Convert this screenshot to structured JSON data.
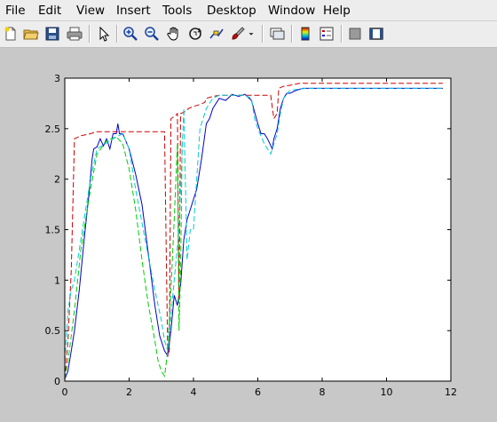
{
  "menu": {
    "items": [
      {
        "label": "File"
      },
      {
        "label": "Edit"
      },
      {
        "label": "View"
      },
      {
        "label": "Insert"
      },
      {
        "label": "Tools"
      },
      {
        "label": "Desktop"
      },
      {
        "label": "Window"
      },
      {
        "label": "Help"
      }
    ]
  },
  "toolbar": {
    "buttons": [
      {
        "icon": "new-file-icon"
      },
      {
        "icon": "open-folder-icon"
      },
      {
        "icon": "save-icon"
      },
      {
        "icon": "print-icon"
      },
      {
        "icon": "pointer-arrow-icon"
      },
      {
        "icon": "zoom-in-icon"
      },
      {
        "icon": "zoom-out-icon"
      },
      {
        "icon": "pan-hand-icon"
      },
      {
        "icon": "rotate-3d-icon"
      },
      {
        "icon": "data-cursor-icon"
      },
      {
        "icon": "brush-icon"
      },
      {
        "icon": "dropdown-arrow-icon"
      },
      {
        "icon": "link-plot-icon"
      },
      {
        "icon": "colorbar-icon"
      },
      {
        "icon": "legend-icon"
      },
      {
        "icon": "hide-plot-tools-icon"
      },
      {
        "icon": "show-plot-tools-icon"
      }
    ]
  },
  "chart_data": {
    "type": "line",
    "title": "",
    "xlabel": "",
    "ylabel": "",
    "xlim": [
      0,
      12
    ],
    "ylim": [
      0,
      3
    ],
    "xticks": [
      "0",
      "2",
      "4",
      "6",
      "8",
      "10",
      "12"
    ],
    "yticks": [
      "0",
      "0.5",
      "1",
      "1.5",
      "2",
      "2.5",
      "3"
    ],
    "grid": false,
    "series": [
      {
        "color": "#0000cc",
        "style": "solid",
        "x": [
          0,
          0.1,
          0.2,
          0.3,
          0.45,
          0.6,
          0.75,
          0.85,
          0.9,
          1.0,
          1.1,
          1.2,
          1.3,
          1.4,
          1.5,
          1.6,
          1.65,
          1.7,
          1.8,
          2.0,
          2.2,
          2.4,
          2.6,
          2.8,
          2.95,
          3.1,
          3.2,
          3.3,
          3.4,
          3.5,
          3.6,
          3.7,
          3.8,
          3.95,
          4.1,
          4.25,
          4.4,
          4.5,
          4.6,
          4.8,
          5.0,
          5.2,
          5.4,
          5.6,
          5.8,
          6.0,
          6.1,
          6.2,
          6.3,
          6.45,
          6.5,
          6.6,
          6.7,
          6.8,
          6.9,
          7.0,
          7.2,
          7.4,
          7.8,
          8.2,
          8.6,
          9.0,
          9.5,
          10.0,
          10.5,
          11.0,
          11.5,
          11.75
        ],
        "y": [
          0.02,
          0.1,
          0.3,
          0.5,
          0.9,
          1.4,
          1.85,
          2.2,
          2.3,
          2.32,
          2.4,
          2.33,
          2.4,
          2.3,
          2.45,
          2.45,
          2.55,
          2.45,
          2.45,
          2.3,
          2.05,
          1.75,
          1.25,
          0.75,
          0.45,
          0.3,
          0.25,
          0.5,
          0.85,
          0.75,
          0.95,
          1.4,
          1.6,
          1.75,
          1.9,
          2.2,
          2.55,
          2.6,
          2.7,
          2.8,
          2.78,
          2.84,
          2.82,
          2.84,
          2.78,
          2.55,
          2.45,
          2.45,
          2.4,
          2.3,
          2.4,
          2.5,
          2.7,
          2.8,
          2.85,
          2.85,
          2.88,
          2.9,
          2.9,
          2.9,
          2.9,
          2.9,
          2.9,
          2.9,
          2.9,
          2.9,
          2.9,
          2.9
        ]
      },
      {
        "color": "#cc0000",
        "style": "dashed",
        "x": [
          0,
          0.1,
          0.2,
          0.3,
          0.5,
          0.8,
          1.0,
          1.5,
          1.8,
          1.9,
          2.1,
          2.5,
          2.9,
          3.1,
          3.2,
          3.25,
          3.3,
          3.4,
          3.5,
          3.55,
          3.6,
          3.75,
          3.85,
          4.0,
          4.2,
          4.35,
          4.4,
          4.6,
          4.8,
          5.0,
          5.5,
          5.8,
          6.0,
          6.2,
          6.4,
          6.5,
          6.6,
          6.65,
          6.8,
          7.0,
          7.3,
          7.4,
          8.0,
          9.0,
          10.0,
          11.0,
          11.75
        ],
        "y": [
          0.02,
          0.4,
          1.1,
          2.4,
          2.43,
          2.45,
          2.47,
          2.47,
          2.47,
          2.47,
          2.47,
          2.47,
          2.47,
          2.47,
          0.25,
          0.3,
          2.6,
          2.62,
          2.65,
          0.8,
          2.65,
          2.67,
          2.7,
          2.72,
          2.74,
          2.76,
          2.8,
          2.82,
          2.83,
          2.83,
          2.83,
          2.83,
          2.83,
          2.83,
          2.83,
          2.6,
          2.65,
          2.9,
          2.92,
          2.93,
          2.95,
          2.95,
          2.95,
          2.95,
          2.95,
          2.95,
          2.95
        ]
      },
      {
        "color": "#00cc00",
        "style": "dashed",
        "x": [
          0,
          0.1,
          0.2,
          0.3,
          0.5,
          0.8,
          1.0,
          1.3,
          1.6,
          1.8,
          2.0,
          2.2,
          2.4,
          2.6,
          2.8,
          2.9,
          3.0,
          3.1,
          3.2,
          3.3,
          3.4,
          3.5,
          3.55,
          3.6,
          3.65
        ],
        "y": [
          0.02,
          0.2,
          0.45,
          0.7,
          1.3,
          1.9,
          2.25,
          2.38,
          2.42,
          2.35,
          2.1,
          1.7,
          1.2,
          0.75,
          0.4,
          0.2,
          0.1,
          0.05,
          0.3,
          0.9,
          1.6,
          2.35,
          0.5,
          1.1,
          2.4
        ]
      },
      {
        "color": "#00cccc",
        "style": "dashed",
        "x": [
          0,
          0.1,
          0.2,
          0.3,
          0.5,
          0.8,
          1.0,
          1.5,
          1.8,
          2.0,
          2.2,
          2.5,
          2.8,
          3.0,
          3.1,
          3.2,
          3.4,
          3.55,
          3.7,
          3.8,
          3.9,
          4.0,
          4.2,
          4.4,
          4.6,
          4.8,
          5.0,
          5.3,
          5.6,
          5.8,
          5.9,
          6.0,
          6.2,
          6.4,
          6.5,
          6.6,
          6.7,
          6.8,
          7.0,
          7.5,
          8.0,
          9.0,
          10.0,
          11.0,
          11.75
        ],
        "y": [
          0.2,
          0.7,
          0.9,
          1.0,
          1.4,
          2.0,
          2.3,
          2.4,
          2.45,
          2.3,
          1.9,
          1.4,
          0.9,
          0.6,
          0.4,
          0.3,
          1.0,
          1.5,
          2.7,
          1.2,
          1.5,
          1.5,
          2.5,
          2.7,
          2.8,
          2.83,
          2.83,
          2.83,
          2.83,
          2.8,
          2.6,
          2.5,
          2.35,
          2.25,
          2.35,
          2.45,
          2.65,
          2.8,
          2.88,
          2.9,
          2.9,
          2.9,
          2.9,
          2.9,
          2.9
        ]
      }
    ]
  }
}
